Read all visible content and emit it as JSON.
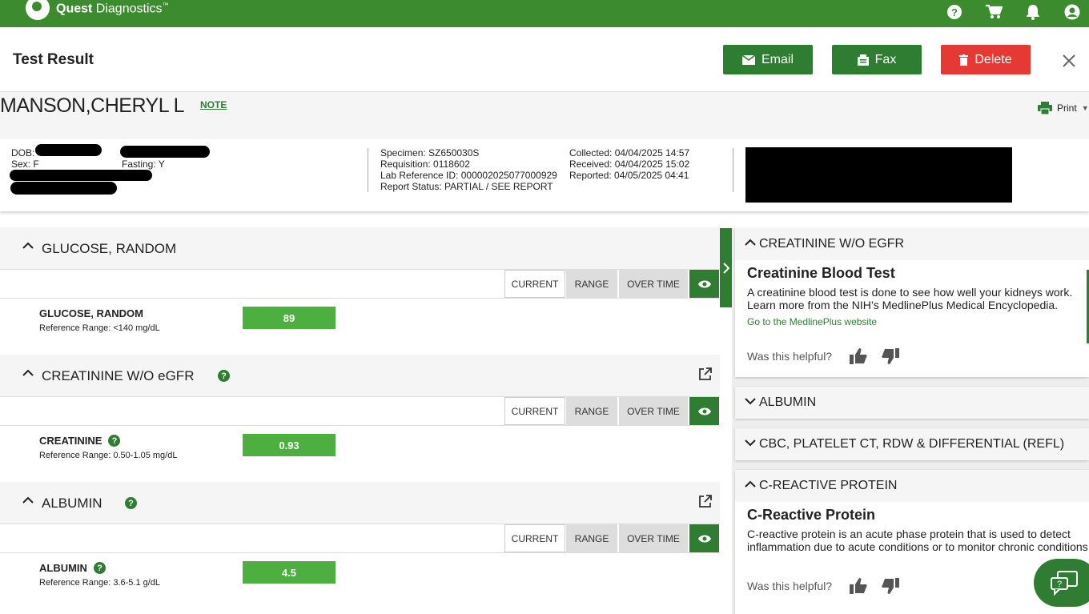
{
  "brand": {
    "name_bold": "Quest",
    "name_rest": "Diagnostics",
    "tm": "™"
  },
  "icons": {
    "help": "help-icon",
    "cart": "cart-icon",
    "bell": "bell-icon",
    "account": "account-icon"
  },
  "colors": {
    "brand_green": "#3d8b2f",
    "button_green": "#2e7d32",
    "delete_red": "#e53935",
    "result_green": "#4caf3f"
  },
  "header": {
    "title": "Test Result",
    "email": "Email",
    "fax": "Fax",
    "delete": "Delete"
  },
  "patient": {
    "name": "MANSON,CHERYL L",
    "note": "NOTE",
    "print": "Print"
  },
  "info": {
    "dob_label": "DOB:",
    "sex": "Sex: F",
    "fasting": "Fasting: Y",
    "specimen": "Specimen: SZ650030S",
    "requisition": "Requisition: 0118602",
    "lab_ref": "Lab Reference ID: 000002025077000929",
    "status": "Report Status: PARTIAL / SEE REPORT",
    "collected": "Collected: 04/04/2025 14:57",
    "received": "Received: 04/04/2025 15:02",
    "reported": "Reported: 04/05/2025 04:41"
  },
  "tabs": {
    "current": "CURRENT",
    "range": "RANGE",
    "over_time": "OVER TIME"
  },
  "sections": [
    {
      "title": "GLUCOSE, RANDOM",
      "result_name": "GLUCOSE, RANDOM",
      "ref": "Reference Range: <140 mg/dL",
      "value": "89"
    },
    {
      "title": "CREATININE W/O eGFR",
      "result_name": "CREATININE",
      "ref": "Reference Range: 0.50-1.05 mg/dL",
      "value": "0.93"
    },
    {
      "title": "ALBUMIN",
      "result_name": "ALBUMIN",
      "ref": "Reference Range: 3.6-5.1 g/dL",
      "value": "4.5"
    }
  ],
  "right": {
    "card1": {
      "head": "CREATININE W/O EGFR",
      "title": "Creatinine Blood Test",
      "desc": "A creatinine blood test is done to see how well your kidneys work. Learn more from the NIH’s MedlinePlus Medical Encyclopedia.",
      "link": "Go to the MedlinePlus website",
      "helpful": "Was this helpful?"
    },
    "card2": {
      "head": "ALBUMIN"
    },
    "card3": {
      "head": "CBC, PLATELET CT, RDW & DIFFERENTIAL (REFL)"
    },
    "card4": {
      "head": "C-REACTIVE PROTEIN",
      "title": "C-Reactive Protein",
      "desc": "C-reactive protein is an acute phase protein that is used to detect inflammation due to acute conditions or to monitor chronic conditions",
      "helpful": "Was this helpful?"
    }
  }
}
